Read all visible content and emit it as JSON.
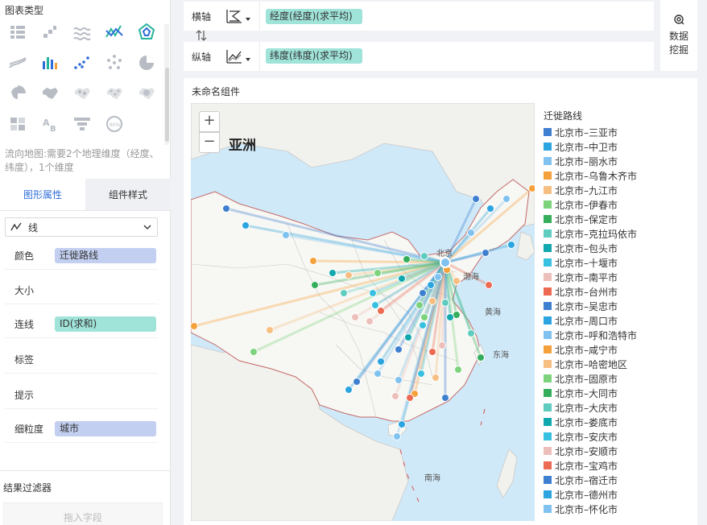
{
  "left_panel": {
    "chart_type_title": "图表类型",
    "chart_type_description": "流向地图:需要2个地理维度（经度、纬度），1个维度",
    "tabs": [
      {
        "label": "图形属性",
        "active": true
      },
      {
        "label": "组件样式",
        "active": false
      }
    ],
    "mark_type": {
      "label": "线"
    },
    "properties": [
      {
        "label": "颜色",
        "pill": "迁徙路线",
        "pill_color": "#c3cff0"
      },
      {
        "label": "大小",
        "pill": ""
      },
      {
        "label": "连线",
        "pill": "ID(求和)",
        "pill_color": "#9fe3d9"
      },
      {
        "label": "标签",
        "pill": ""
      },
      {
        "label": "提示",
        "pill": ""
      },
      {
        "label": "细粒度",
        "pill": "城市",
        "pill_color": "#c3cff0"
      }
    ],
    "result_filter": {
      "title": "结果过滤器",
      "drop_placeholder": "拖入字段"
    }
  },
  "axes": {
    "x_axis": {
      "label": "横轴",
      "field": "经度(经度)(求平均)"
    },
    "y_axis": {
      "label": "纵轴",
      "field": "纬度(纬度)(求平均)"
    }
  },
  "data_mining": {
    "line1": "数据",
    "line2": "挖掘"
  },
  "component": {
    "title": "未命名组件",
    "map": {
      "zoom_in": "+",
      "zoom_out": "−",
      "continent_label": "亚洲",
      "labels": {
        "beijing": "北京",
        "bohai": "渤海",
        "yellow_sea": "黄海",
        "east_sea": "东海",
        "south_sea": "南海"
      }
    },
    "legend": {
      "title": "迁徙路线",
      "items": [
        {
          "label": "北京市–三亚市",
          "color": "#3f7fd0"
        },
        {
          "label": "北京市–中卫市",
          "color": "#2ba4df"
        },
        {
          "label": "北京市–丽水市",
          "color": "#80c2ef"
        },
        {
          "label": "北京市–乌鲁木齐市",
          "color": "#f5a13b"
        },
        {
          "label": "北京市–九江市",
          "color": "#f7be82"
        },
        {
          "label": "北京市–伊春市",
          "color": "#7cd37c"
        },
        {
          "label": "北京市–保定市",
          "color": "#35ae5c"
        },
        {
          "label": "北京市–克拉玛依市",
          "color": "#5fccc0"
        },
        {
          "label": "北京市–包头市",
          "color": "#12a8b0"
        },
        {
          "label": "北京市–十堰市",
          "color": "#38c0e0"
        },
        {
          "label": "北京市–南平市",
          "color": "#edbfbb"
        },
        {
          "label": "北京市–台州市",
          "color": "#ec6a52"
        },
        {
          "label": "北京市–吴忠市",
          "color": "#3f7fd0"
        },
        {
          "label": "北京市–周口市",
          "color": "#2ba4df"
        },
        {
          "label": "北京市–呼和浩特市",
          "color": "#80c2ef"
        },
        {
          "label": "北京市–咸宁市",
          "color": "#f5a13b"
        },
        {
          "label": "北京市–哈密地区",
          "color": "#f7be82"
        },
        {
          "label": "北京市–固原市",
          "color": "#7cd37c"
        },
        {
          "label": "北京市–大同市",
          "color": "#35ae5c"
        },
        {
          "label": "北京市–大庆市",
          "color": "#5fccc0"
        },
        {
          "label": "北京市–娄底市",
          "color": "#12a8b0"
        },
        {
          "label": "北京市–安庆市",
          "color": "#38c0e0"
        },
        {
          "label": "北京市–安顺市",
          "color": "#edbfbb"
        },
        {
          "label": "北京市–宝鸡市",
          "color": "#ec6a52"
        },
        {
          "label": "北京市–宿迁市",
          "color": "#3f7fd0"
        },
        {
          "label": "北京市–德州市",
          "color": "#2ba4df"
        },
        {
          "label": "北京市–怀化市",
          "color": "#80c2ef"
        }
      ]
    }
  },
  "colors": {
    "accent": "#2f6dd9",
    "pill_blue": "#c3cff0",
    "pill_teal": "#9fe3d9",
    "sea": "#cfe9f8"
  }
}
